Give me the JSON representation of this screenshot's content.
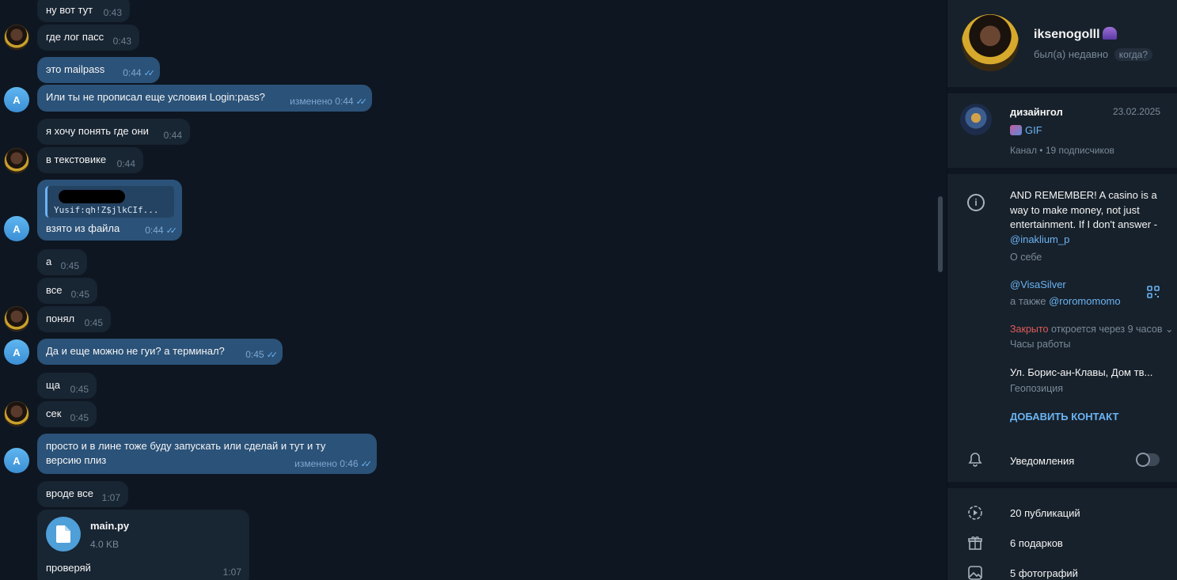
{
  "chat": {
    "messages": [
      {
        "text": "ну вот тут",
        "time": "0:43"
      },
      {
        "text": "где лог пасс",
        "time": "0:43"
      },
      {
        "text": "это mailpass",
        "time": "0:44"
      },
      {
        "text": "Или ты не прописал еще условия Login:pass?",
        "time": "изменено 0:44"
      },
      {
        "text": "я хочу понять где они",
        "time": "0:44"
      },
      {
        "text": "в текстовике",
        "time": "0:44"
      },
      {
        "reply_snippet": "Yusif:qh!Z$jlkCIf...",
        "text": "взято из файла",
        "time": "0:44"
      },
      {
        "text": "а",
        "time": "0:45"
      },
      {
        "text": "все",
        "time": "0:45"
      },
      {
        "text": "понял",
        "time": "0:45"
      },
      {
        "text": "Да и еще можно не гуи? а терминал?",
        "time": "0:45"
      },
      {
        "text": "ща",
        "time": "0:45"
      },
      {
        "text": "сек",
        "time": "0:45"
      },
      {
        "text_line1": "просто и в лине тоже буду запускать или сделай и тут и ту",
        "text_line2": "версию плиз",
        "time": "изменено 0:46"
      },
      {
        "text": "вроде все",
        "time": "1:07"
      },
      {
        "file_name": "main.py",
        "file_size": "4.0 KB",
        "text": "проверяй",
        "time": "1:07"
      }
    ],
    "avatar_letter": "A",
    "read_ticks": "✓✓"
  },
  "profile": {
    "name": "iksenogolll",
    "status": "был(а) недавно",
    "when_label": "когда?",
    "channel": {
      "name": "дизайнгол",
      "date": "23.02.2025",
      "last_post": "GIF",
      "subtitle": "Канал • 19 подписчиков"
    },
    "bio": {
      "text_prefix": "AND REMEMBER! A casino is a way to make money, not just entertainment. If I don't answer - ",
      "text_link": "@inaklium_p",
      "label": "О себе"
    },
    "username": {
      "primary": "@VisaSilver",
      "also_prefix": "а также ",
      "also_link": "@roromomomo"
    },
    "hours": {
      "status_red": "Закрыто",
      "status_text": "откроется через 9 часов",
      "label": "Часы работы"
    },
    "location": {
      "text": "Ул. Борис-ан-Клавы, Дом тв...",
      "label": "Геопозиция"
    },
    "add_contact": "ДОБАВИТЬ КОНТАКТ",
    "notifications": "Уведомления",
    "stats": [
      {
        "icon": "stories-icon",
        "label": "20 публикаций"
      },
      {
        "icon": "gift-icon",
        "label": "6 подарков"
      },
      {
        "icon": "photo-icon",
        "label": "5 фотографий"
      }
    ]
  }
}
